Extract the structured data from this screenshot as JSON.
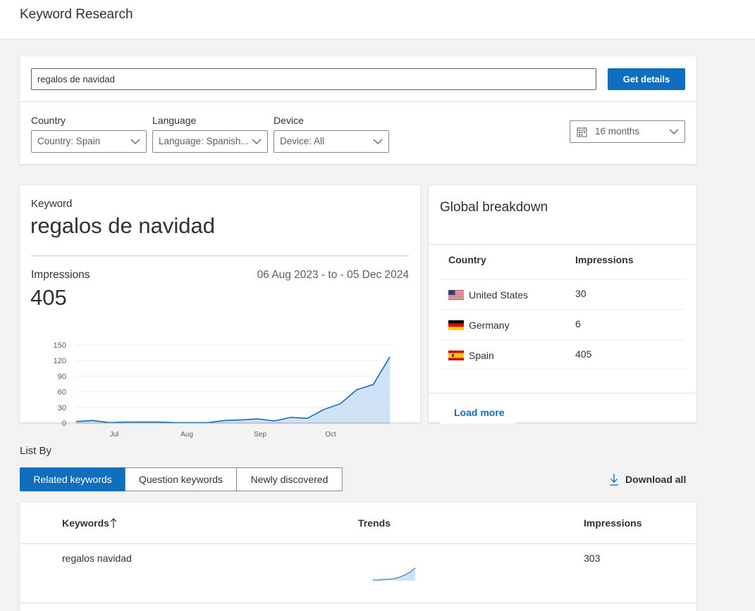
{
  "header": {
    "title": "Keyword Research"
  },
  "search": {
    "value": "regalos de navidad",
    "button_label": "Get details"
  },
  "filters": {
    "country": {
      "label": "Country",
      "value": "Country: Spain"
    },
    "language": {
      "label": "Language",
      "value": "Language: Spanish..."
    },
    "device": {
      "label": "Device",
      "value": "Device: All"
    },
    "date_range": {
      "value": "16 months",
      "icon": "calendar-icon"
    }
  },
  "keyword_card": {
    "label": "Keyword",
    "keyword": "regalos de navidad",
    "impressions_label": "Impressions",
    "date_range": "06 Aug 2023 - to - 05 Dec 2024",
    "impressions_value": "405"
  },
  "chart_data": {
    "type": "area",
    "x_ticks": [
      "Jul",
      "Aug",
      "Sep",
      "Oct"
    ],
    "y_ticks": [
      "150",
      "120",
      "90",
      "60",
      "30",
      "0"
    ],
    "ylim": [
      0,
      150
    ],
    "values": [
      3,
      5,
      1,
      2,
      2,
      2,
      1,
      1,
      1,
      5,
      6,
      8,
      4,
      11,
      9,
      26,
      37,
      64,
      74,
      127
    ],
    "color": "#106ebe",
    "fill": "#cfe2f6",
    "grid": true
  },
  "global_breakdown": {
    "title": "Global breakdown",
    "col_country": "Country",
    "col_impressions": "Impressions",
    "rows": [
      {
        "country": "United States",
        "impressions": "30",
        "flag": "us-flag-icon"
      },
      {
        "country": "Germany",
        "impressions": "6",
        "flag": "de-flag-icon"
      },
      {
        "country": "Spain",
        "impressions": "405",
        "flag": "es-flag-icon"
      }
    ],
    "load_more": "Load more"
  },
  "list_by": {
    "label": "List By",
    "tabs": [
      {
        "label": "Related keywords",
        "active": true
      },
      {
        "label": "Question keywords",
        "active": false
      },
      {
        "label": "Newly discovered",
        "active": false
      }
    ],
    "download_label": "Download all"
  },
  "keywords_table": {
    "columns": [
      "Keywords",
      "Trends",
      "Impressions"
    ],
    "rows": [
      {
        "keyword": "regalos navidad",
        "impressions": "303",
        "trend": [
          1,
          1,
          2,
          2,
          3,
          5,
          8,
          12,
          18
        ]
      }
    ]
  }
}
